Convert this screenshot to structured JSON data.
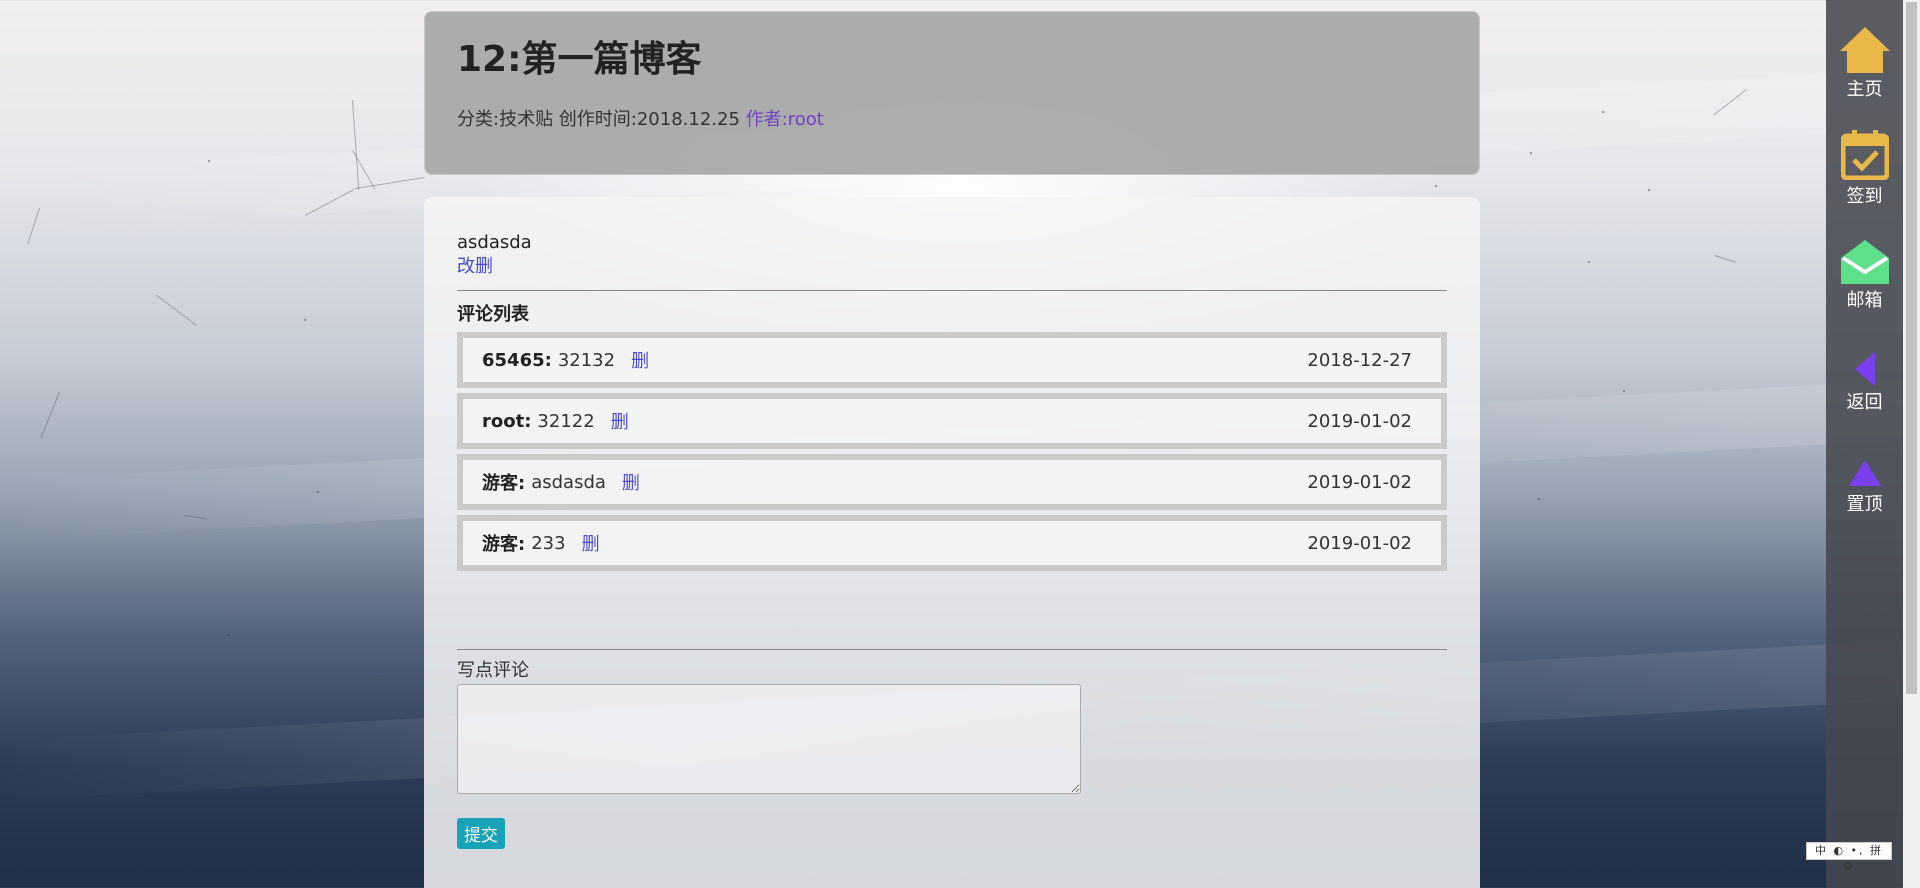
{
  "post": {
    "title": "12:第一篇博客",
    "meta_category": "分类:技术贴 创作时间:2018.12.25 ",
    "meta_author": "作者:root",
    "body": "asdasda",
    "edit_delete": "改删"
  },
  "comments": {
    "heading": "评论列表",
    "items": [
      {
        "author": "65465:",
        "text": "32132",
        "delete": "删",
        "date": "2018-12-27"
      },
      {
        "author": "root:",
        "text": "32122",
        "delete": "删",
        "date": "2019-01-02"
      },
      {
        "author": "游客:",
        "text": "asdasda",
        "delete": "删",
        "date": "2019-01-02"
      },
      {
        "author": "游客:",
        "text": "233",
        "delete": "删",
        "date": "2019-01-02"
      }
    ]
  },
  "form": {
    "label": "写点评论",
    "textarea_value": "",
    "submit": "提交"
  },
  "sidebar": {
    "items": [
      {
        "label": "主页",
        "icon": "home-icon",
        "color": "#e8b84a"
      },
      {
        "label": "签到",
        "icon": "calendar-check-icon",
        "color": "#e8b84a"
      },
      {
        "label": "邮箱",
        "icon": "mail-icon",
        "color": "#5ee08a"
      },
      {
        "label": "返回",
        "icon": "back-arrow-icon",
        "color": "#7b3ff0"
      },
      {
        "label": "置顶",
        "icon": "top-arrow-icon",
        "color": "#7b3ff0"
      }
    ]
  },
  "ime": {
    "text": "中 ◐ •, 拼 ⚙"
  },
  "colors": {
    "link": "#4a4ad6",
    "author_link": "#6f42c1",
    "submit_button": "#17a2b8",
    "header_card": "#a6a6a6"
  }
}
